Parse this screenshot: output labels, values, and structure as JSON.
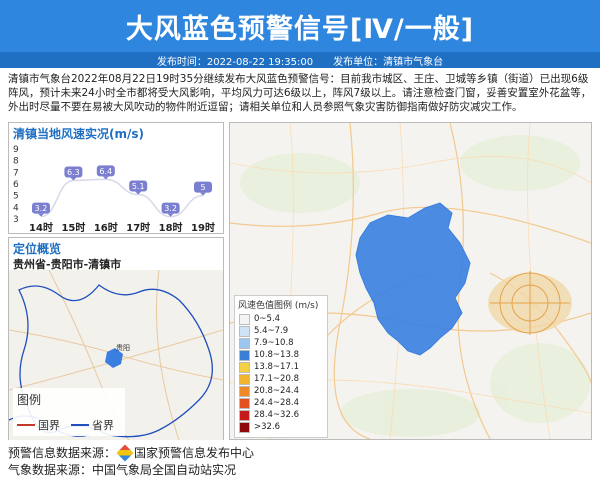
{
  "header": {
    "title": "大风蓝色预警信号[Ⅳ/一般]",
    "publish_time": "发布时间：2022-08-22 19:35:00",
    "publisher": "发布单位：清镇市气象台"
  },
  "body_text": "清镇市气象台2022年08月22日19时35分继续发布大风蓝色预警信号：目前我市城区、王庄、卫城等乡镇（街道）已出现6级阵风，预计未来24小时全市都将受大风影响，平均风力可达6级以上，阵风7级以上。请注意检查门窗，妥善安置室外花盆等，外出时尽量不要在易被大风吹动的物件附近逗留；请相关单位和人员参照气象灾害防御指南做好防灾减灾工作。",
  "wind_panel": {
    "title": "清镇当地风速实况(m/s)"
  },
  "chart_data": {
    "type": "line",
    "categories": [
      "14时",
      "15时",
      "16时",
      "17时",
      "18时",
      "19时"
    ],
    "values": [
      3.2,
      6.3,
      6.4,
      5.1,
      3.2,
      5
    ],
    "value_labels": [
      "3.2",
      "6.3",
      "6.4",
      "5.1",
      "3.2",
      "5"
    ],
    "yticks": [
      "9",
      "8",
      "7",
      "6",
      "5",
      "4",
      "3"
    ],
    "ylim": [
      3,
      9
    ],
    "line_color": "#d8d8e8",
    "bubble_color": "#7b7fd0"
  },
  "location_panel": {
    "title": "定位概览",
    "subtitle": "贵州省-贵阳市-清镇市",
    "city_label": "贵阳",
    "legend_title": "图例",
    "legend_items": [
      {
        "label": "国界",
        "color": "#c0392b"
      },
      {
        "label": "省界",
        "color": "#1f4fbf"
      }
    ]
  },
  "map_panel": {
    "legend_title": "风速色值图例 (m/s)",
    "legend_items": [
      {
        "label": "0~5.4",
        "color": "#f4f4f4"
      },
      {
        "label": "5.4~7.9",
        "color": "#cfe3f7"
      },
      {
        "label": "7.9~10.8",
        "color": "#9cc6ef"
      },
      {
        "label": "10.8~13.8",
        "color": "#3a7fd6"
      },
      {
        "label": "13.8~17.1",
        "color": "#f5d142"
      },
      {
        "label": "17.1~20.8",
        "color": "#f2b530"
      },
      {
        "label": "20.8~24.4",
        "color": "#f08a24"
      },
      {
        "label": "24.4~28.4",
        "color": "#e5501f"
      },
      {
        "label": "28.4~32.6",
        "color": "#c81a1a"
      },
      {
        "label": ">32.6",
        "color": "#8e0b0b"
      }
    ],
    "warning_region_color": "#3a7fe0"
  },
  "footer": {
    "source_label": "预警信息数据来源：",
    "source_name": "国家预警信息发布中心",
    "second_line": "气象数据来源：中国气象局全国自动站实况"
  }
}
